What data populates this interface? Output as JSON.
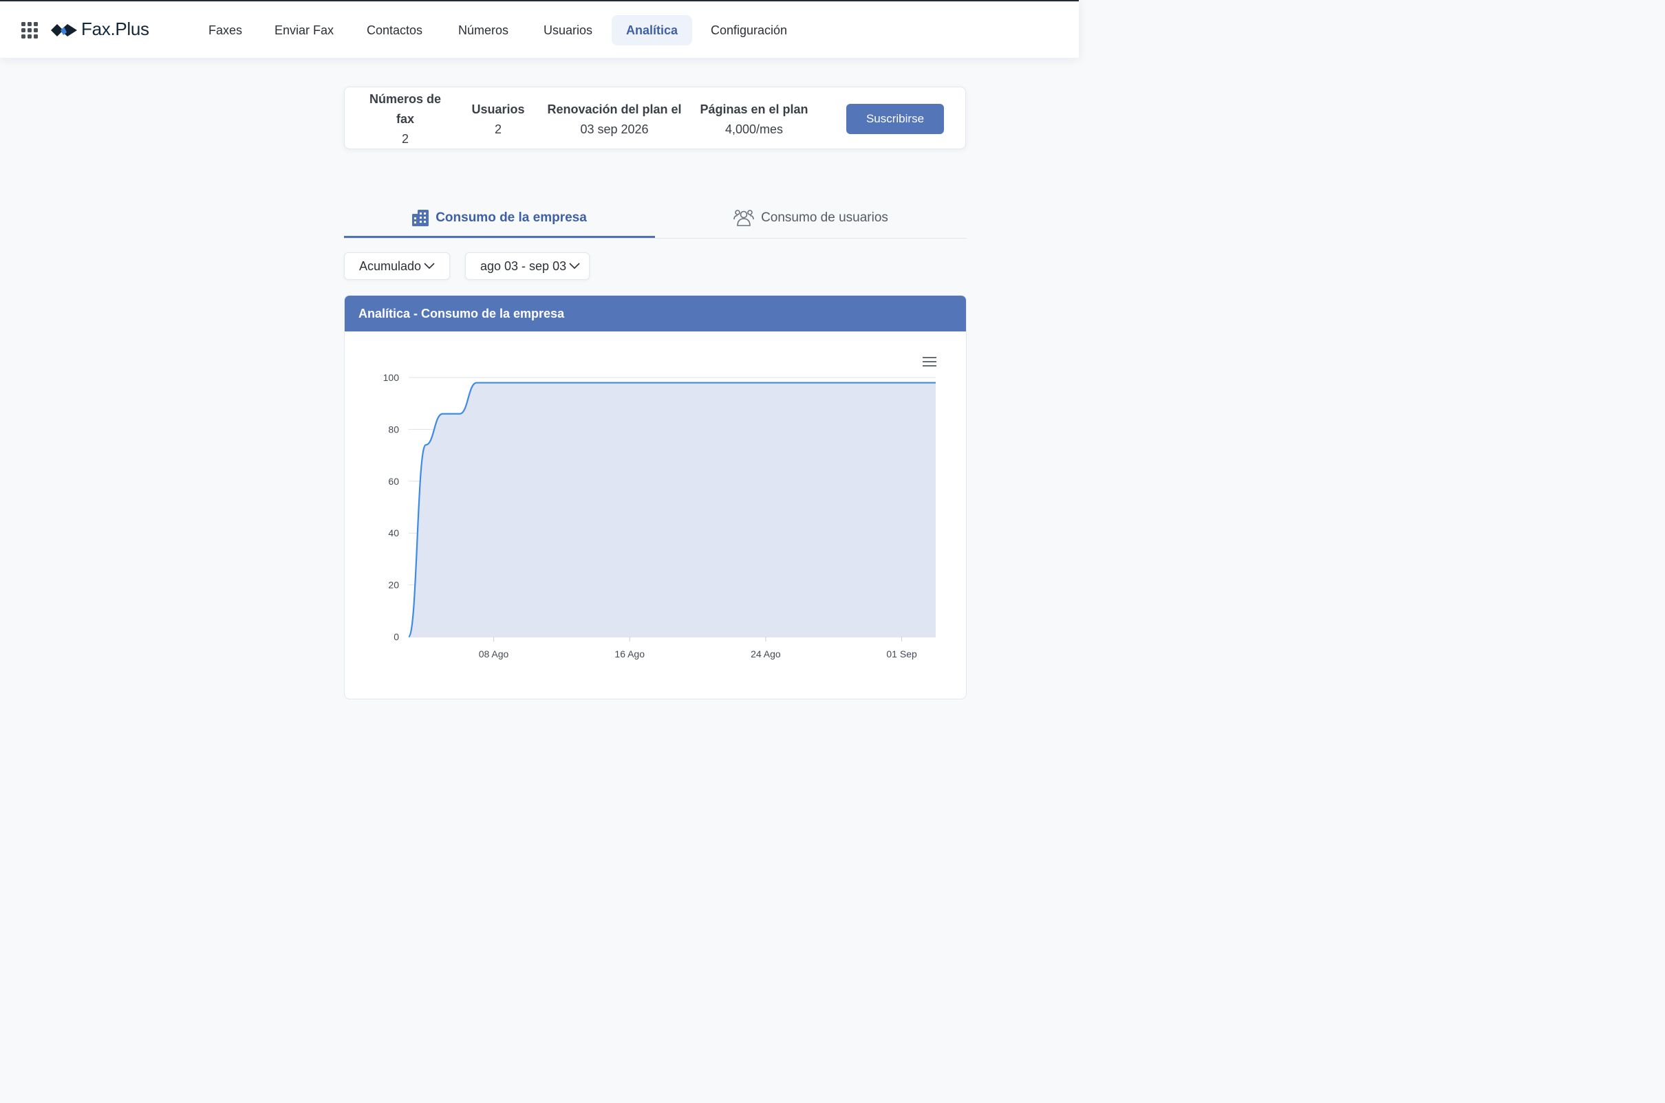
{
  "header": {
    "logo_text": "Fax.Plus",
    "nav": [
      {
        "label": "Faxes",
        "active": false
      },
      {
        "label": "Enviar Fax",
        "active": false
      },
      {
        "label": "Contactos",
        "active": false
      },
      {
        "label": "Números",
        "active": false
      },
      {
        "label": "Usuarios",
        "active": false
      },
      {
        "label": "Analítica",
        "active": true
      },
      {
        "label": "Configuración",
        "active": false
      }
    ]
  },
  "plan": {
    "fax_numbers_label": "Números de fax",
    "fax_numbers_value": "2",
    "users_label": "Usuarios",
    "users_value": "2",
    "renewal_label": "Renovación del plan el",
    "renewal_value": "03 sep 2026",
    "pages_label": "Páginas en el plan",
    "pages_value": "4,000/mes",
    "subscribe_label": "Suscribirse"
  },
  "tabs": [
    {
      "label": "Consumo de la empresa",
      "icon": "building-icon",
      "active": true
    },
    {
      "label": "Consumo de usuarios",
      "icon": "users-icon",
      "active": false
    }
  ],
  "filters": {
    "mode": "Acumulado",
    "range": "ago 03 - sep 03"
  },
  "panel": {
    "title": "Analítica - Consumo de la empresa"
  },
  "colors": {
    "accent": "#5475b8",
    "line": "#3d8be8",
    "area": "#dde4f1"
  },
  "chart_data": {
    "type": "area",
    "title": "",
    "xlabel": "",
    "ylabel": "",
    "ylim": [
      0,
      100
    ],
    "yticks": [
      "0",
      "20",
      "40",
      "60",
      "80",
      "100"
    ],
    "xticks": [
      "08 Ago",
      "16 Ago",
      "24 Ago",
      "01 Sep"
    ],
    "x": [
      "03 Ago",
      "04 Ago",
      "05 Ago",
      "06 Ago",
      "07 Ago",
      "08 Ago",
      "09 Ago",
      "10 Ago",
      "11 Ago",
      "12 Ago",
      "13 Ago",
      "14 Ago",
      "15 Ago",
      "16 Ago",
      "17 Ago",
      "18 Ago",
      "19 Ago",
      "20 Ago",
      "21 Ago",
      "22 Ago",
      "23 Ago",
      "24 Ago",
      "25 Ago",
      "26 Ago",
      "27 Ago",
      "28 Ago",
      "29 Ago",
      "30 Ago",
      "31 Ago",
      "01 Sep",
      "02 Sep",
      "03 Sep"
    ],
    "series": [
      {
        "values": [
          0,
          74,
          86,
          86,
          98,
          98,
          98,
          98,
          98,
          98,
          98,
          98,
          98,
          98,
          98,
          98,
          98,
          98,
          98,
          98,
          98,
          98,
          98,
          98,
          98,
          98,
          98,
          98,
          98,
          98,
          98,
          98
        ]
      }
    ],
    "grid": true,
    "legend": "none"
  }
}
